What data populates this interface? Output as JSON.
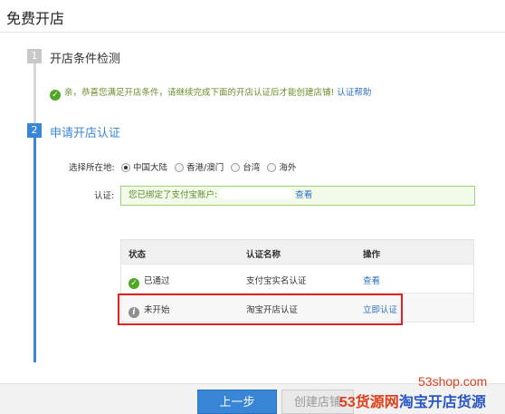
{
  "header": {
    "title": "免费开店"
  },
  "step1": {
    "number": "1",
    "title": "开店条件检测",
    "notice": {
      "text": "亲，恭喜您满足开店条件，请继续完成下面的开店认证后才能创建店铺! ",
      "help": "认证帮助"
    }
  },
  "step2": {
    "number": "2",
    "title": "申请开店认证"
  },
  "location": {
    "label": "选择所在地:",
    "options": [
      "中国大陆",
      "香港/澳门",
      "台湾",
      "海外"
    ],
    "selected": "中国大陆"
  },
  "auth": {
    "label": "认证:",
    "bound_text": "您已绑定了支付宝账户:",
    "view": "查看"
  },
  "table": {
    "headers": [
      "状态",
      "认证名称",
      "操作"
    ],
    "rows": [
      {
        "status": "已通过",
        "status_icon": "check-icon",
        "name": "支付宝实名认证",
        "action": "查看"
      },
      {
        "status": "未开始",
        "status_icon": "info-icon",
        "name": "淘宝开店认证",
        "action": "立即认证"
      }
    ]
  },
  "buttons": {
    "prev": "上一步",
    "create": "创建店铺"
  },
  "watermark": {
    "url": "53shop.com",
    "brand_main": "53货源网",
    "brand_sub": "淘宝开店货源"
  },
  "colors": {
    "accent": "#3a86d6",
    "success": "#4ea823",
    "highlight": "#e2201f",
    "link": "#2b6fc4"
  }
}
